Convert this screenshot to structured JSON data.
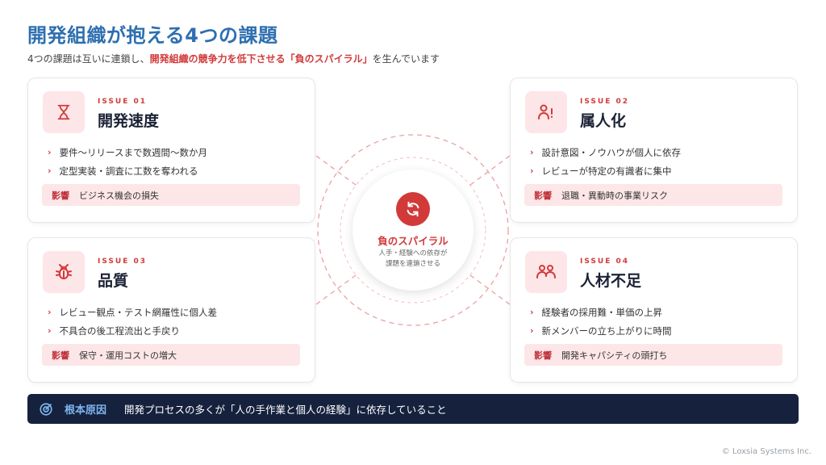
{
  "title": "開発組織が抱える4つの課題",
  "subtitle": {
    "pre": "4つの課題は互いに連鎖し、",
    "highlight": "開発組織の競争力を低下させる「負のスパイラル」",
    "post": "を生んでいます"
  },
  "issues": [
    {
      "issue_label": "ISSUE 01",
      "name": "開発速度",
      "icon": "hourglass-icon",
      "bullets": [
        "要件〜リリースまで数週間〜数か月",
        "定型実装・調査に工数を奪われる"
      ],
      "impact_label": "影響",
      "impact": "ビジネス機会の損失"
    },
    {
      "issue_label": "ISSUE 02",
      "name": "属人化",
      "icon": "person-alert-icon",
      "bullets": [
        "設計意図・ノウハウが個人に依存",
        "レビューが特定の有識者に集中"
      ],
      "impact_label": "影響",
      "impact": "退職・異動時の事業リスク"
    },
    {
      "issue_label": "ISSUE 03",
      "name": "品質",
      "icon": "bug-icon",
      "bullets": [
        "レビュー観点・テスト網羅性に個人差",
        "不具合の後工程流出と手戻り"
      ],
      "impact_label": "影響",
      "impact": "保守・運用コストの増大"
    },
    {
      "issue_label": "ISSUE 04",
      "name": "人材不足",
      "icon": "people-icon",
      "bullets": [
        "経験者の採用難・単価の上昇",
        "新メンバーの立ち上がりに時間"
      ],
      "impact_label": "影響",
      "impact": "開発キャパシティの頭打ち"
    }
  ],
  "center": {
    "icon": "refresh-cycle-icon",
    "title": "負のスパイラル",
    "desc_line1": "人手・経験への依存が",
    "desc_line2": "課題を連鎖させる"
  },
  "root_cause": {
    "icon": "target-icon",
    "label": "根本原因",
    "text": "開発プロセスの多くが「人の手作業と個人の経験」に依存していること"
  },
  "copyright": "© Loxsia Systems Inc.",
  "colors": {
    "accent": "#d23a3a",
    "title": "#2e6fb0",
    "navy": "#15213d",
    "pink_bg": "#fde6e7"
  }
}
